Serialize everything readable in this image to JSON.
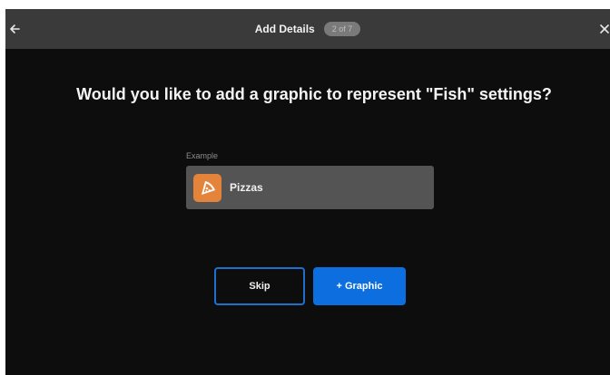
{
  "header": {
    "title": "Add Details",
    "step_badge": "2 of 7",
    "back_icon": "arrow-left-icon",
    "close_icon": "close-icon"
  },
  "main": {
    "question": "Would you like to add a graphic to represent \"Fish\" settings?",
    "example_label": "Example",
    "example_item": {
      "icon": "pizza-icon",
      "label": "Pizzas"
    }
  },
  "actions": {
    "skip_label": "Skip",
    "graphic_label": "+ Graphic"
  },
  "colors": {
    "header_bg": "#3a3a3a",
    "body_bg": "#0d0d0d",
    "card_bg": "#545454",
    "accent_blue": "#0d6ee0",
    "icon_orange": "#e4843a"
  }
}
